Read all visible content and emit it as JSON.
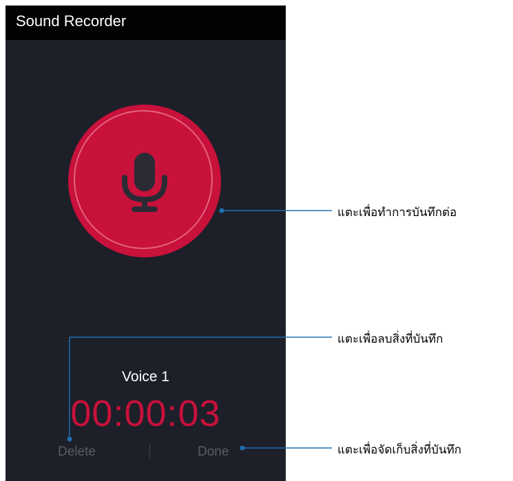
{
  "app": {
    "title": "Sound Recorder"
  },
  "recording": {
    "name": "Voice 1",
    "timer": "00:00:03"
  },
  "actions": {
    "delete_label": "Delete",
    "done_label": "Done"
  },
  "callouts": {
    "resume": "แตะเพื่อทำการบันทึกต่อ",
    "delete": "แตะเพื่อลบสิ่งที่บันทึก",
    "save": "แตะเพื่อจัดเก็บสิ่งที่บันทึก"
  },
  "colors": {
    "accent": "#c8113b",
    "background": "#1d1f29",
    "titlebar": "#020202",
    "callout_line": "#1e6fb0"
  },
  "icons": {
    "record": "microphone-icon"
  }
}
